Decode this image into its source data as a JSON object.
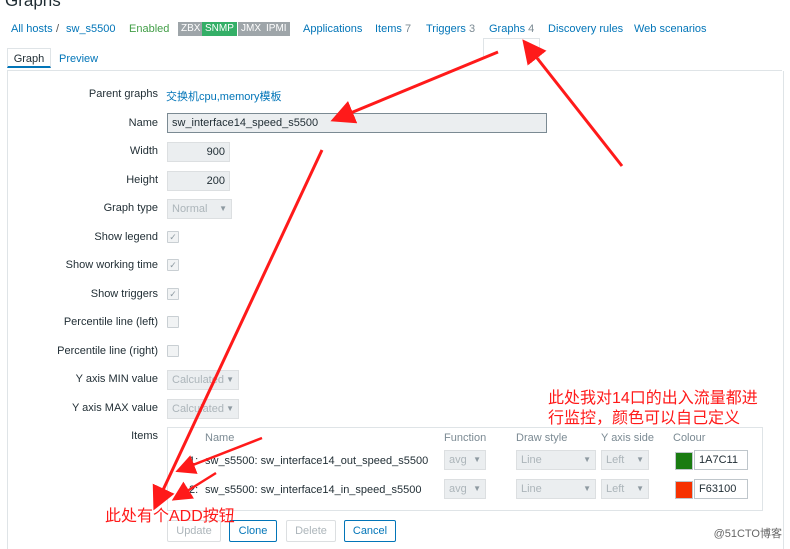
{
  "page": {
    "title": "Graphs"
  },
  "nav": {
    "all_hosts": "All hosts",
    "separator": "/",
    "host": "sw_s5500",
    "status": "Enabled",
    "badges": [
      {
        "label": "ZBX",
        "color": "#9ea5a9"
      },
      {
        "label": "SNMP",
        "color": "#34af67"
      },
      {
        "label": "JMX",
        "color": "#9ea5a9"
      },
      {
        "label": "IPMI",
        "color": "#9ea5a9"
      }
    ],
    "applications": "Applications",
    "items": "Items",
    "items_count": "7",
    "triggers": "Triggers",
    "triggers_count": "3",
    "graphs": "Graphs",
    "graphs_count": "4",
    "discovery": "Discovery rules",
    "web": "Web scenarios"
  },
  "form_tabs": {
    "graph": "Graph",
    "preview": "Preview"
  },
  "form": {
    "parent_graphs_label": "Parent graphs",
    "parent_graphs_value": "交换机cpu,memory模板",
    "name_label": "Name",
    "name_value": "sw_interface14_speed_s5500",
    "width_label": "Width",
    "width_value": "900",
    "height_label": "Height",
    "height_value": "200",
    "graph_type_label": "Graph type",
    "graph_type_value": "Normal",
    "show_legend_label": "Show legend",
    "show_working_time_label": "Show working time",
    "show_triggers_label": "Show triggers",
    "percentile_left_label": "Percentile line (left)",
    "percentile_right_label": "Percentile line (right)",
    "ymin_label": "Y axis MIN value",
    "ymin_value": "Calculated",
    "ymax_label": "Y axis MAX value",
    "ymax_value": "Calculated",
    "items_label": "Items"
  },
  "items_table": {
    "headers": [
      "Name",
      "Function",
      "Draw style",
      "Y axis side",
      "Colour"
    ],
    "rows": [
      {
        "index": "1:",
        "name": "sw_s5500: sw_interface14_out_speed_s5500",
        "function": "avg",
        "draw_style": "Line",
        "y_axis_side": "Left",
        "colour": "1A7C11",
        "swatch": "#1A7C11"
      },
      {
        "index": "2:",
        "name": "sw_s5500: sw_interface14_in_speed_s5500",
        "function": "avg",
        "draw_style": "Line",
        "y_axis_side": "Left",
        "colour": "F63100",
        "swatch": "#F63100"
      }
    ]
  },
  "buttons": {
    "update": "Update",
    "clone": "Clone",
    "delete": "Delete",
    "cancel": "Cancel"
  },
  "annotations": {
    "note_top_line1": "此处我对14口的出入流量都进",
    "note_top_line2": "行监控，颜色可以自己定义",
    "note_bottom": "此处有个ADD按钮",
    "arrow_color": "#ff1a1a"
  },
  "watermark": "@51CTO博客"
}
